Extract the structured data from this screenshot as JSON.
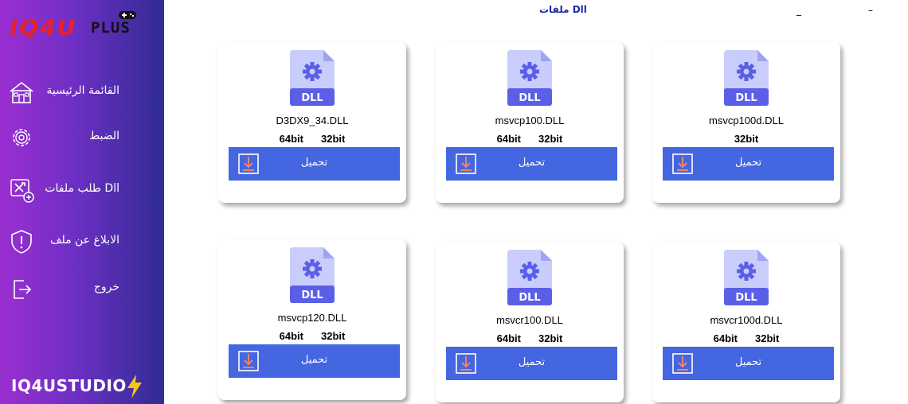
{
  "app": {
    "logo_main": "IQ4U",
    "logo_plus": "PLUS",
    "studio": "IQ4USTUDIO",
    "title": "ملفات Dll",
    "minimize_symbol": "_",
    "close_symbol": "–"
  },
  "sidebar": {
    "items": [
      {
        "label": "القائمة الرئيسية",
        "icon": "home-icon"
      },
      {
        "label": "الضبط",
        "icon": "gear-icon"
      },
      {
        "label": "طلب ملفات Dll",
        "icon": "tools-request-icon"
      },
      {
        "label": "الابلاغ عن ملف",
        "icon": "shield-warning-icon"
      },
      {
        "label": "خروج",
        "icon": "exit-icon"
      }
    ]
  },
  "cards": [
    {
      "name": "msvcp100d.DLL",
      "bits": [
        "32bit"
      ],
      "download_label": "تحميل",
      "badge": "DLL"
    },
    {
      "name": "msvcp100.DLL",
      "bits": [
        "64bit",
        "32bit"
      ],
      "download_label": "تحميل",
      "badge": "DLL"
    },
    {
      "name": "D3DX9_34.DLL",
      "bits": [
        "64bit",
        "32bit"
      ],
      "download_label": "تحميل",
      "badge": "DLL"
    },
    {
      "name": "msvcr100d.DLL",
      "bits": [
        "64bit",
        "32bit"
      ],
      "download_label": "تحميل",
      "badge": "DLL"
    },
    {
      "name": "msvcr100.DLL",
      "bits": [
        "64bit",
        "32bit"
      ],
      "download_label": "تحميل",
      "badge": "DLL"
    },
    {
      "name": "msvcp120.DLL",
      "bits": [
        "64bit",
        "32bit"
      ],
      "download_label": "تحميل",
      "badge": "DLL"
    }
  ],
  "colors": {
    "accent_blue": "#4466e0",
    "file_icon_light": "#c9cdfb",
    "file_icon_dark": "#5b5fe8",
    "download_arrow": "#f0836f"
  }
}
